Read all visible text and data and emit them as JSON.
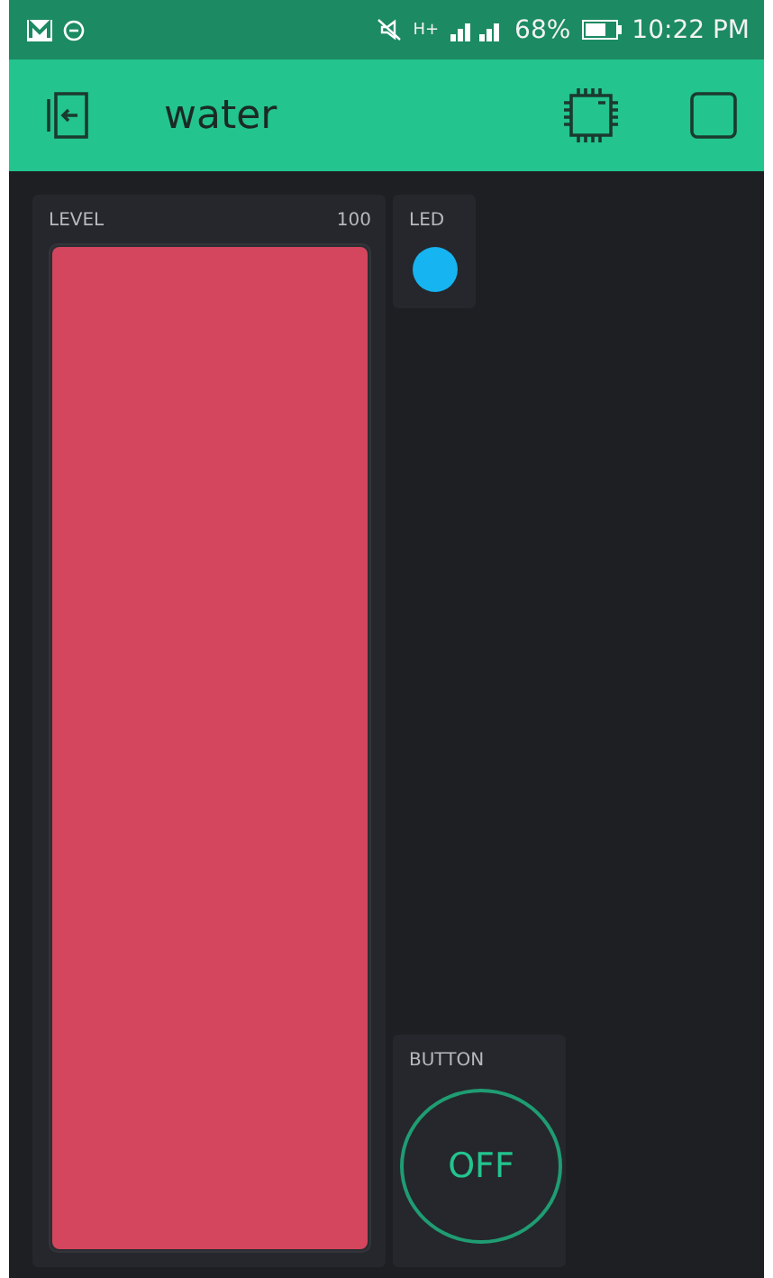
{
  "status_bar": {
    "network": "H+",
    "battery": "68%",
    "time": "10:22 PM"
  },
  "app_bar": {
    "title": "water"
  },
  "widgets": [
    {
      "kind": "level",
      "label": "LEVEL",
      "max": "100",
      "level": 1.0,
      "color": "#d3465e"
    },
    {
      "kind": "led",
      "label": "LED",
      "on": true,
      "color": "#16b4f0"
    },
    {
      "kind": "button",
      "label": "BUTTON",
      "value": "OFF",
      "on": false
    }
  ]
}
